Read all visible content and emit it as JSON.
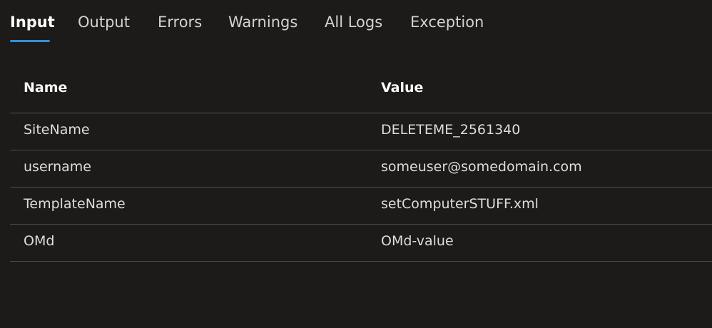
{
  "tabs": [
    {
      "label": "Input",
      "active": true
    },
    {
      "label": "Output",
      "active": false
    },
    {
      "label": "Errors",
      "active": false
    },
    {
      "label": "Warnings",
      "active": false
    },
    {
      "label": "All Logs",
      "active": false
    },
    {
      "label": "Exception",
      "active": false
    }
  ],
  "table": {
    "columns": [
      "Name",
      "Value"
    ],
    "rows": [
      {
        "name": "SiteName",
        "value": "DELETEME_2561340"
      },
      {
        "name": "username",
        "value": "someuser@somedomain.com"
      },
      {
        "name": "TemplateName",
        "value": "setComputerSTUFF.xml"
      },
      {
        "name": "OMd",
        "value": "OMd-value"
      }
    ]
  },
  "colors": {
    "background": "#1c1b1a",
    "accent": "#2f8fd8",
    "divider": "#4a4a4a"
  }
}
